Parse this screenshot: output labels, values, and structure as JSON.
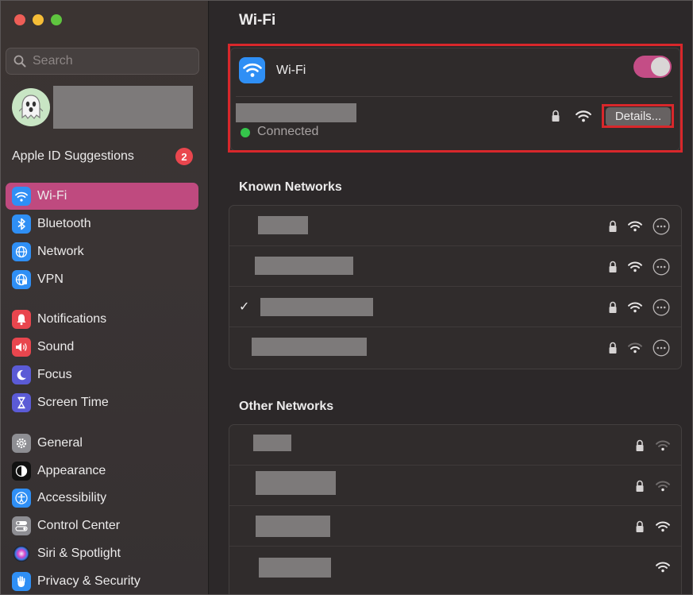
{
  "sidebar": {
    "search_placeholder": "Search",
    "apple_id": {
      "label": "Apple ID Suggestions",
      "badge": "2"
    },
    "items": [
      {
        "label": "Wi-Fi",
        "icon": "wifi-icon",
        "color": "#2f8ff5",
        "selected": true
      },
      {
        "label": "Bluetooth",
        "icon": "bluetooth-icon",
        "color": "#2f8ff5"
      },
      {
        "label": "Network",
        "icon": "globe-icon",
        "color": "#2f8ff5"
      },
      {
        "label": "VPN",
        "icon": "vpn-globe-icon",
        "color": "#2f8ff5"
      },
      {
        "label": "Notifications",
        "icon": "bell-icon",
        "color": "#e9464e"
      },
      {
        "label": "Sound",
        "icon": "speaker-icon",
        "color": "#e9464e"
      },
      {
        "label": "Focus",
        "icon": "moon-icon",
        "color": "#5b5bd6"
      },
      {
        "label": "Screen Time",
        "icon": "hourglass-icon",
        "color": "#5b5bd6"
      },
      {
        "label": "General",
        "icon": "gear-icon",
        "color": "#8e8e93"
      },
      {
        "label": "Appearance",
        "icon": "appearance-icon",
        "color": "#111111"
      },
      {
        "label": "Accessibility",
        "icon": "accessibility-icon",
        "color": "#2f8ff5"
      },
      {
        "label": "Control Center",
        "icon": "toggles-icon",
        "color": "#8e8e93"
      },
      {
        "label": "Siri & Spotlight",
        "icon": "siri-icon",
        "color": "#000000"
      },
      {
        "label": "Privacy & Security",
        "icon": "hand-icon",
        "color": "#2f8ff5"
      }
    ]
  },
  "main": {
    "title": "Wi-Fi",
    "wifi_card": {
      "label": "Wi-Fi",
      "toggle_on": true,
      "status": "Connected",
      "details_button": "Details..."
    },
    "known_networks": {
      "title": "Known Networks",
      "rows": [
        {
          "checked": false,
          "signal": "strong",
          "locked": true
        },
        {
          "checked": false,
          "signal": "strong",
          "locked": true
        },
        {
          "checked": true,
          "check_glyph": "✓",
          "signal": "strong",
          "locked": true
        },
        {
          "checked": false,
          "signal": "medium",
          "locked": true
        }
      ]
    },
    "other_networks": {
      "title": "Other Networks",
      "rows": [
        {
          "signal": "weak",
          "locked": true
        },
        {
          "signal": "weak",
          "locked": true
        },
        {
          "signal": "strong",
          "locked": true
        },
        {
          "signal": "strong",
          "locked": false
        }
      ]
    }
  },
  "colors": {
    "accent_selected": "#bf4a7f",
    "highlight_border": "#d8272b",
    "connected_dot": "#35c54b"
  }
}
